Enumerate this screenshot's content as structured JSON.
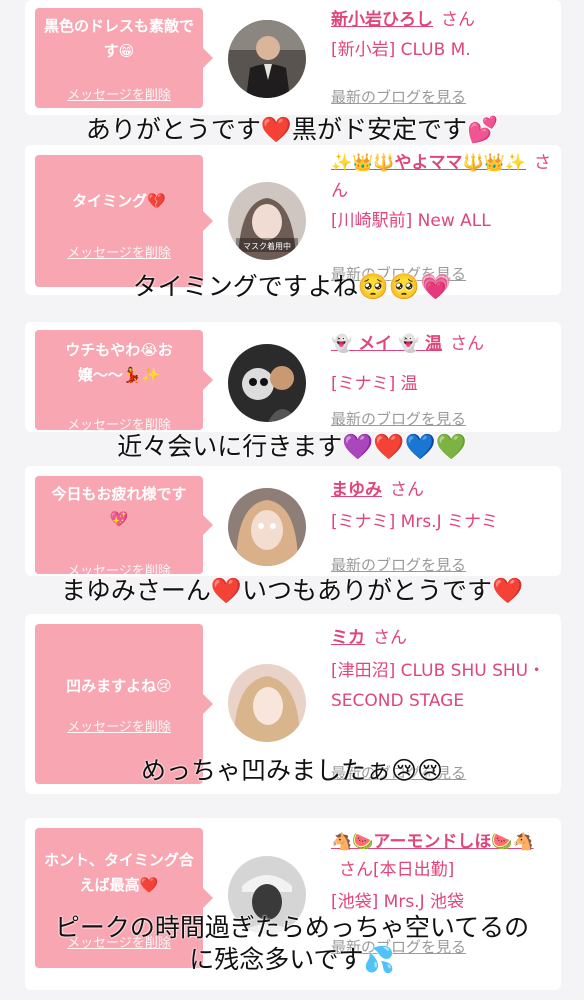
{
  "entries": [
    {
      "message": "黒色のドレスも素敵です😁",
      "delete_label": "メッセージを削除",
      "name": "新小岩ひろし",
      "san": "さん",
      "shop": "[新小岩] CLUB M.",
      "blog_label": "最新のブログを見る",
      "avatar_hint": "man-in-suit"
    },
    {
      "message": "タイミング💔",
      "delete_label": "メッセージを削除",
      "name": "✨👑🔱やよママ🔱👑✨",
      "san": "さん",
      "shop": "[川崎駅前] New ALL",
      "blog_label": "最新のブログを見る",
      "avatar_text": "マスク着用中"
    },
    {
      "message": "ウチもやわ😭お嬢〜〜💃✨",
      "delete_label": "メッセージを削除",
      "name": "👻 メイ 👻 温",
      "san": "さん",
      "shop": "[ミナミ] 温",
      "blog_label": "最新のブログを見る"
    },
    {
      "message": "今日もお疲れ様です💖",
      "delete_label": "メッセージを削除",
      "name": "まゆみ",
      "san": "さん",
      "shop": "[ミナミ] Mrs.J ミナミ",
      "blog_label": "最新のブログを見る"
    },
    {
      "message": "凹みますよね😢",
      "delete_label": "メッセージを削除",
      "name": "ミカ",
      "san": "さん",
      "shop": "[津田沼] CLUB SHU SHU・SECOND STAGE",
      "blog_label": "最新のブログを見る"
    },
    {
      "message": "ホント、タイミング合えば最高❤️",
      "delete_label": "メッセージを削除",
      "name": "🐴🍉アーモンドしほ🍉🐴",
      "san": "さん[本日出勤]",
      "shop": "[池袋] Mrs.J 池袋",
      "blog_label": "最新のブログを見る"
    }
  ],
  "captions": [
    "ありがとうです❤️黒がド安定です💕",
    "タイミングですよね🥺🥺💗",
    "近々会いに行きます💜❤️💙💚",
    "まゆみさーん❤️いつもありがとうです❤️",
    "めっちゃ凹みましたぁ😢😢",
    "ピークの時間過ぎたらめっちゃ空いてるのに残念多いです💦"
  ],
  "caption_lines": {
    "c6_line1": "ピークの時間過ぎたらめっちゃ空いてるの",
    "c6_line2": "に残念多いです💦"
  },
  "colors": {
    "bubble": "#f7a6b2",
    "name": "#e0457b",
    "blog": "#9a9a9a",
    "background": "#f4f4f6"
  }
}
